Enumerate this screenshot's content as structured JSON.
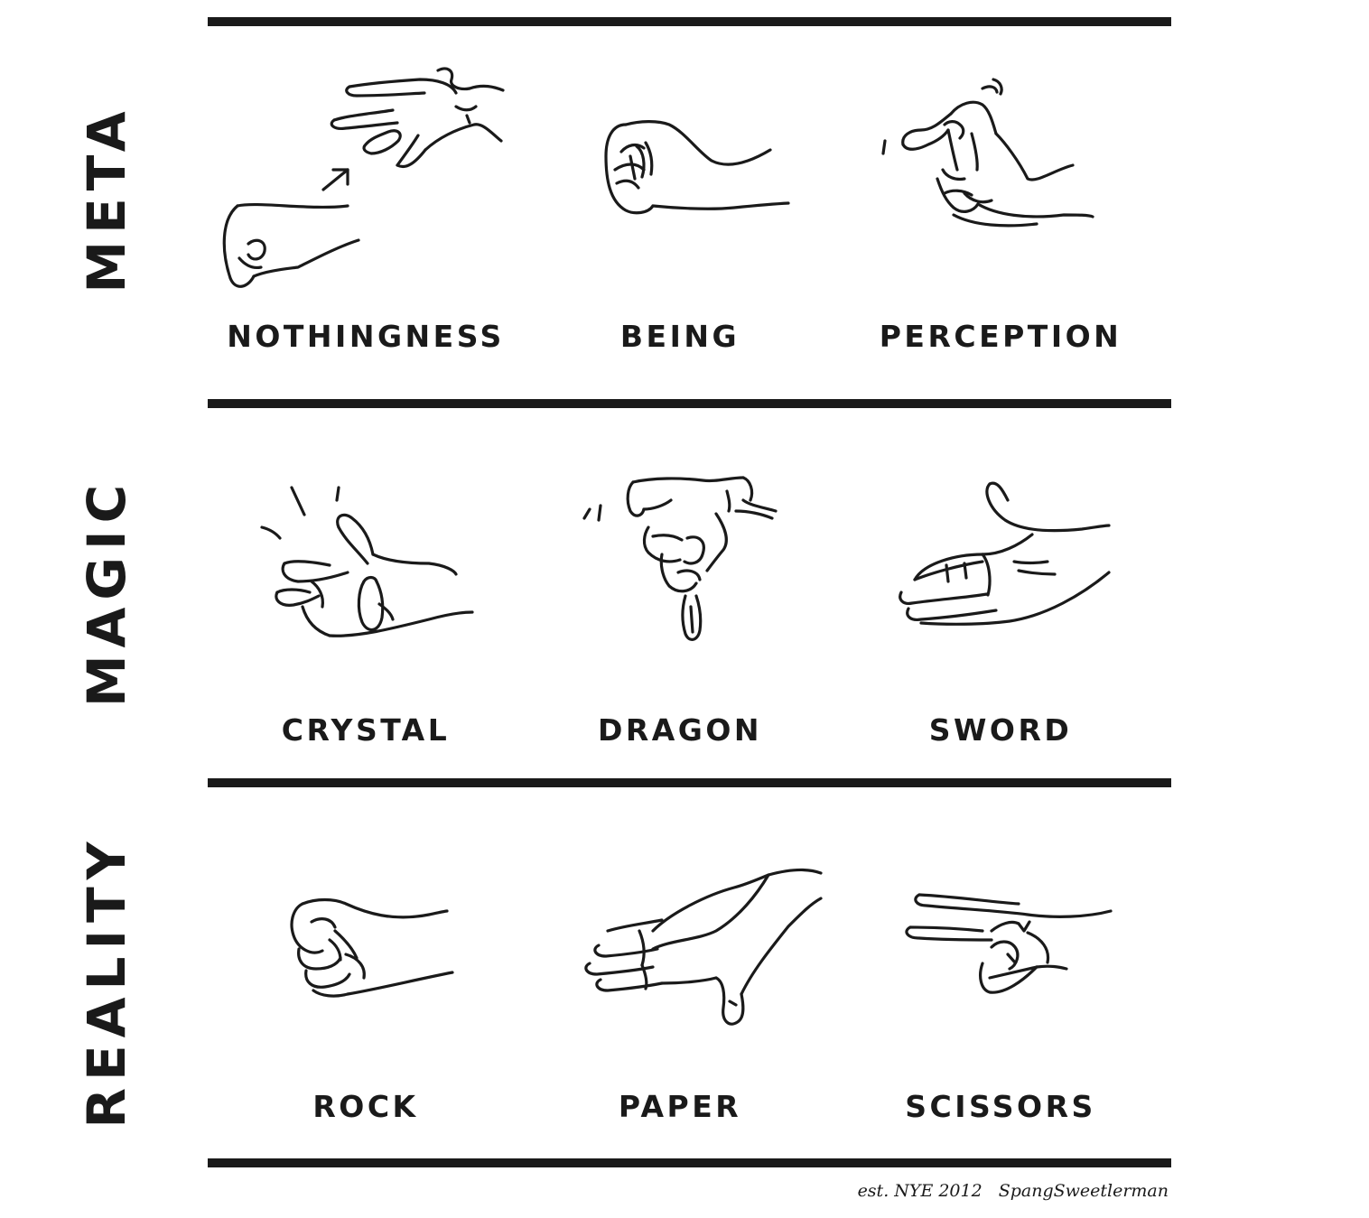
{
  "sections": [
    {
      "label": "META",
      "gestures": [
        {
          "name": "NOTHINGNESS",
          "icon": "nothingness-hand-icon"
        },
        {
          "name": "BEING",
          "icon": "being-hand-icon"
        },
        {
          "name": "PERCEPTION",
          "icon": "perception-hand-icon"
        }
      ]
    },
    {
      "label": "MAGIC",
      "gestures": [
        {
          "name": "CRYSTAL",
          "icon": "crystal-hand-icon"
        },
        {
          "name": "DRAGON",
          "icon": "dragon-hand-icon"
        },
        {
          "name": "SWORD",
          "icon": "sword-hand-icon"
        }
      ]
    },
    {
      "label": "REALITY",
      "gestures": [
        {
          "name": "ROCK",
          "icon": "rock-hand-icon"
        },
        {
          "name": "PAPER",
          "icon": "paper-hand-icon"
        },
        {
          "name": "SCISSORS",
          "icon": "scissors-hand-icon"
        }
      ]
    }
  ],
  "credit": {
    "est": "est. NYE 2012",
    "author": "SpangSweetlerman"
  },
  "colors": {
    "ink": "#1a1a1a",
    "background": "#ffffff"
  }
}
